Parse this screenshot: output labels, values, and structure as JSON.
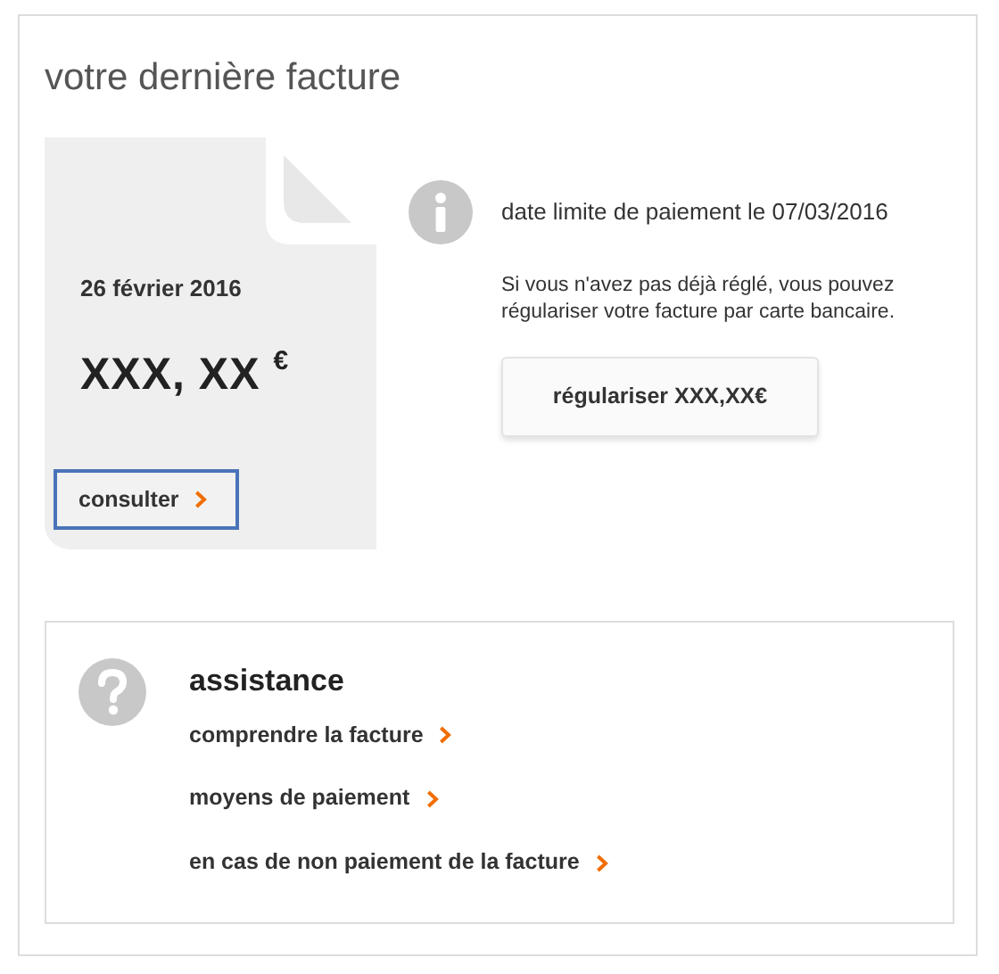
{
  "title": "votre dernière facture",
  "invoice": {
    "date": "26 février 2016",
    "amount": "XXX, XX $^{€}$",
    "button": "consulter"
  },
  "payment": {
    "deadline": "date limite de paiement le 07/03/2016",
    "note": "Si vous n'avez pas déjà réglé, vous pouvez régulariser votre facture par carte bancaire.",
    "button": "régulariser XXX,XX€"
  },
  "assistance": {
    "title": "assistance",
    "links": [
      {
        "label": "comprendre la facture"
      },
      {
        "label": "moyens de paiement"
      },
      {
        "label": "en cas de non paiement de la facture"
      }
    ]
  }
}
